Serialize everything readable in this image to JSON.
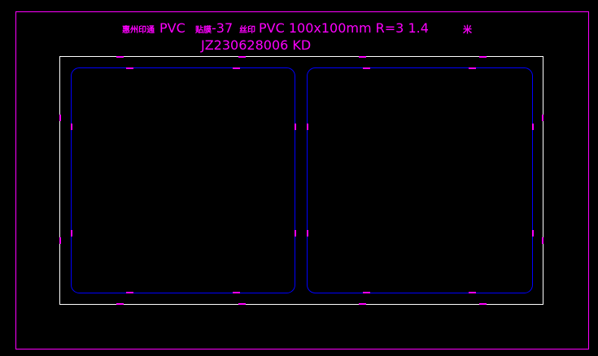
{
  "drawing": {
    "title_prefix": "惠州印通",
    "title_mid": "PVC",
    "title_small_1": "贴膜",
    "title_part_2": "-37",
    "title_small_2": "丝印",
    "title_suffix": "PVC  100x100mm  R=3   1.4",
    "title_unit": "米",
    "job_code": "JZ230628006  KD"
  },
  "colors": {
    "background": "#000000",
    "frame": "#ff00ff",
    "sheet": "#ffffff",
    "cut_line": "#0000ff",
    "marks": "#ff00ff",
    "text": "#ff00ff"
  }
}
